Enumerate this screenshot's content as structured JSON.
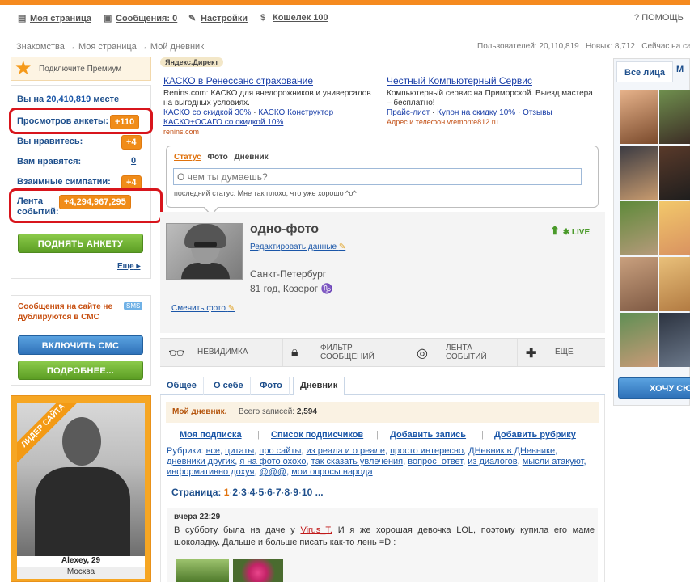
{
  "topnav": {
    "my_page": "Моя страница",
    "messages": "Сообщения: 0",
    "settings": "Настройки",
    "wallet": "Кошелек 100",
    "help": "ПОМОЩЬ"
  },
  "breadcrumb": [
    "Знакомства",
    "Моя страница",
    "Мой дневник"
  ],
  "site_stats": {
    "users": "Пользователей: 20,110,819",
    "new": "Новых: 8,712",
    "online": "Сейчас на са"
  },
  "premium": {
    "label": "Подключите Премиум"
  },
  "rating": {
    "rank_prefix": "Вы на",
    "rank_value": "20,410,819",
    "rank_suffix": "месте",
    "views_label": "Просмотров анкеты:",
    "views_badge": "+110",
    "you_like_label": "Вы нравитесь:",
    "you_like_badge": "+4",
    "they_like_label": "Вам нравятся:",
    "they_like_value": "0",
    "mutual_label": "Взаимные симпатии:",
    "mutual_badge": "+4",
    "feed_label_1": "Лента",
    "feed_label_2": "событий:",
    "feed_badge": "+4,294,967,295",
    "raise_button": "ПОДНЯТЬ АНКЕТУ",
    "more_link": "Еще"
  },
  "sms": {
    "text": "Сообщения на сайте не дублируются в СМС",
    "tag": "SMS",
    "enable_button": "ВКЛЮЧИТЬ СМС",
    "details_button": "ПОДРОБНЕЕ..."
  },
  "leader": {
    "ribbon": "ЛИДЕР САЙТА",
    "name": "Alexey, 29",
    "city": "Москва"
  },
  "ads": {
    "label": "Яндекс.Директ",
    "left": {
      "title": "КАСКО в Ренессанс страхование",
      "desc": "Renins.com: КАСКО для внедорожников и универсалов на выгодных условиях.",
      "link1": "КАСКО со скидкой 30%",
      "link2": "КАСКО Конструктор",
      "link3": "КАСКО+ОСАГО со скидкой 10%",
      "domain": "renins.com"
    },
    "right": {
      "title": "Честный Компьютерный Сервис",
      "desc": "Компьютерный сервис на Приморской. Выезд мастера – бесплатно!",
      "link1": "Прайс-лист",
      "link2": "Купон на скидку 10%",
      "link3": "Отзывы",
      "domain": "Адрес и телефон  vremonte812.ru"
    }
  },
  "status": {
    "tab_status": "Статус",
    "tab_photo": "Фото",
    "tab_diary": "Дневник",
    "placeholder": "О чем ты думаешь?",
    "last": "последний статус: Мне так плохо, что уже хорошо ^o^"
  },
  "profile": {
    "name": "одно-фото",
    "edit": "Редактировать данные",
    "city": "Санкт-Петербург",
    "age": "81 год, Козерог",
    "change_photo": "Сменить фото",
    "live": "LIVE"
  },
  "actions": {
    "invisible": "НЕВИДИМКА",
    "filter_1": "ФИЛЬТР",
    "filter_2": "СООБЩЕНИЙ",
    "feed_1": "ЛЕНТА",
    "feed_2": "СОБЫТИЙ",
    "more": "ЕЩЕ"
  },
  "tabs": [
    "Общее",
    "О себе",
    "Фото",
    "Дневник"
  ],
  "diary": {
    "title": "Мой дневник.",
    "count_label": "Всего записей:",
    "count": "2,594",
    "links": [
      "Моя подписка",
      "Список подписчиков",
      "Добавить запись",
      "Добавить рубрику"
    ],
    "rubrics_label": "Рубрики:",
    "rubrics": [
      "все",
      "цитаты",
      "про сайты",
      "из реала и о реале",
      "просто интересно",
      "ДНевник в ДНевнике",
      "дневники других",
      "я на фото охохо",
      "так сказать увлечения",
      "вопрос_ответ",
      "из диалогов",
      "мысли атакуют",
      "информативно дохуя",
      "@@@",
      "мои опросы народа"
    ],
    "pages_label": "Страница:",
    "pages": [
      "1",
      "2",
      "3",
      "4",
      "5",
      "6",
      "7",
      "8",
      "9",
      "10"
    ],
    "ellipsis": "...",
    "post_time": "вчера 22:29",
    "post_text_1": "В субботу была на даче у",
    "post_user": "Virus_T.",
    "post_text_2": "И я же хорошая девочка LOL, поэтому купила его маме шоколадку. Дальше и больше писать как-то лень =D :"
  },
  "right": {
    "tab_faces": "Все лица",
    "tab_other": "М",
    "want_button": "ХОЧУ СЮ"
  },
  "colors": {
    "accent_orange": "#f08c19",
    "link_blue": "#1a56a8",
    "highlight_red": "#d8151c",
    "green_button": "#5c9e24",
    "blue_button": "#2f72b9"
  }
}
